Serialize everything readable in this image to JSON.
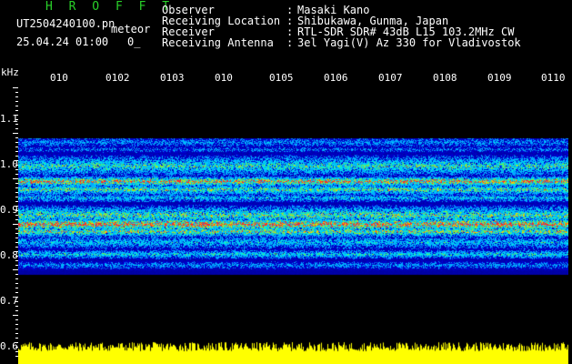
{
  "header": {
    "title": "H R O F F T",
    "filename": "UT2504240100.pn",
    "mode": "meteor",
    "datetime": "25.04.24 01:00",
    "flag": "0_"
  },
  "info": [
    {
      "label": "Observer",
      "sep": ":",
      "value": "Masaki Kano"
    },
    {
      "label": "Receiving Location",
      "sep": ":",
      "value": "Shibukawa, Gunma, Japan"
    },
    {
      "label": "Receiver",
      "sep": ":",
      "value": "RTL-SDR SDR# 43dB L15 103.2MHz CW"
    },
    {
      "label": "Receiving Antenna",
      "sep": ":",
      "value": "3el Yagi(V) Az 330 for Vladivostok"
    }
  ],
  "axis": {
    "unit": "kHz",
    "time_ticks": [
      "010",
      "0102",
      "0103",
      "010",
      "0105",
      "0106",
      "0107",
      "0108",
      "0109",
      "0110"
    ],
    "freq_ticks": [
      "1.1",
      "1.0",
      "0.9",
      "0.8",
      "0.7",
      "0.6"
    ]
  },
  "colors": {
    "title": "#29d029",
    "amplitude": "#ffff00",
    "background": "#000000"
  }
}
